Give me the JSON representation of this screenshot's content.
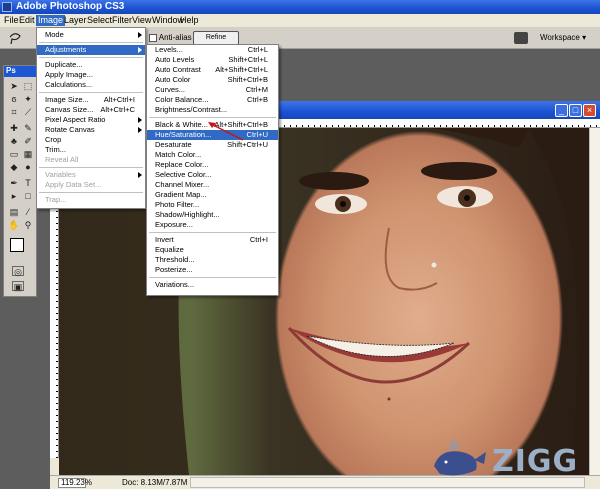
{
  "app": {
    "title": "Adobe Photoshop CS3",
    "logo": "Ps"
  },
  "menubar": [
    "File",
    "Edit",
    "Image",
    "Layer",
    "Select",
    "Filter",
    "View",
    "Window",
    "Help"
  ],
  "active_menu": "Image",
  "options": {
    "anti_alias": "Anti-alias",
    "refine_edge": "Refine Edge...",
    "workspace": "Workspace"
  },
  "image_menu": [
    {
      "label": "Mode",
      "submenu": true
    },
    {
      "sep": true
    },
    {
      "label": "Adjustments",
      "submenu": true,
      "highlighted": true
    },
    {
      "sep": true
    },
    {
      "label": "Duplicate..."
    },
    {
      "label": "Apply Image..."
    },
    {
      "label": "Calculations..."
    },
    {
      "sep": true
    },
    {
      "label": "Image Size...",
      "shortcut": "Alt+Ctrl+I"
    },
    {
      "label": "Canvas Size...",
      "shortcut": "Alt+Ctrl+C"
    },
    {
      "label": "Pixel Aspect Ratio",
      "submenu": true
    },
    {
      "label": "Rotate Canvas",
      "submenu": true
    },
    {
      "label": "Crop"
    },
    {
      "label": "Trim..."
    },
    {
      "label": "Reveal All",
      "disabled": true
    },
    {
      "sep": true
    },
    {
      "label": "Variables",
      "submenu": true,
      "disabled": true
    },
    {
      "label": "Apply Data Set...",
      "disabled": true
    },
    {
      "sep": true
    },
    {
      "label": "Trap...",
      "disabled": true
    }
  ],
  "adjustments_menu": [
    {
      "label": "Levels...",
      "shortcut": "Ctrl+L"
    },
    {
      "label": "Auto Levels",
      "shortcut": "Shift+Ctrl+L"
    },
    {
      "label": "Auto Contrast",
      "shortcut": "Alt+Shift+Ctrl+L"
    },
    {
      "label": "Auto Color",
      "shortcut": "Shift+Ctrl+B"
    },
    {
      "label": "Curves...",
      "shortcut": "Ctrl+M"
    },
    {
      "label": "Color Balance...",
      "shortcut": "Ctrl+B"
    },
    {
      "label": "Brightness/Contrast..."
    },
    {
      "sep": true
    },
    {
      "label": "Black & White...",
      "shortcut": "Alt+Shift+Ctrl+B"
    },
    {
      "label": "Hue/Saturation...",
      "shortcut": "Ctrl+U",
      "highlighted": true
    },
    {
      "label": "Desaturate",
      "shortcut": "Shift+Ctrl+U"
    },
    {
      "label": "Match Color..."
    },
    {
      "label": "Replace Color..."
    },
    {
      "label": "Selective Color..."
    },
    {
      "label": "Channel Mixer..."
    },
    {
      "label": "Gradient Map..."
    },
    {
      "label": "Photo Filter..."
    },
    {
      "label": "Shadow/Highlight..."
    },
    {
      "label": "Exposure..."
    },
    {
      "sep": true
    },
    {
      "label": "Invert",
      "shortcut": "Ctrl+I"
    },
    {
      "label": "Equalize"
    },
    {
      "label": "Threshold..."
    },
    {
      "label": "Posterize..."
    },
    {
      "sep": true
    },
    {
      "label": "Variations..."
    }
  ],
  "status": {
    "zoom": "119.23%",
    "doc": "Doc: 8.13M/7.87M"
  },
  "watermark": "ZIGG",
  "colors": {
    "highlight": "#316ac5",
    "titlebar": "#1b52d3",
    "menu_bg": "#ece9d8"
  }
}
